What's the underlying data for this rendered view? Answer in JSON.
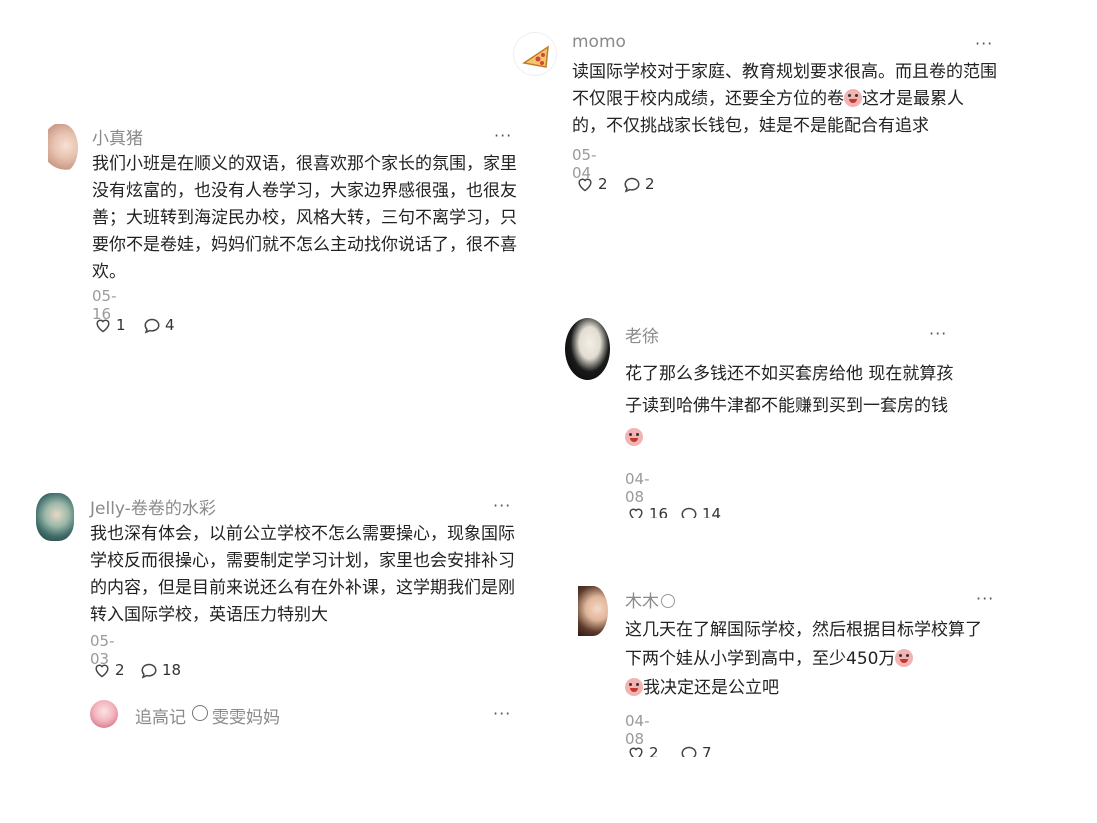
{
  "comments": [
    {
      "name": "小真猪",
      "text": "我们小班是在顺义的双语，很喜欢那个家长的氛围，家里没有炫富的，也没有人卷学习，大家边界感很强，也很友善；大班转到海淀民办校，风格大转，三句不离学习，只要你不是卷娃，妈妈们就不怎么主动找你说话了，很不喜欢。",
      "date": "05-16",
      "likes": "1",
      "replies": "4"
    },
    {
      "name": "Jelly-卷卷的水彩",
      "text": "我也深有体会，以前公立学校不怎么需要操心，现象国际学校反而很操心，需要制定学习计划，家里也会安排补习的内容，但是目前来说还么有在外补课，这学期我们是刚转入国际学校，英语压力特别大",
      "date": "05-03",
      "likes": "2",
      "replies": "18",
      "reply_preview": {
        "name": "追高记",
        "target": "雯雯妈妈"
      }
    },
    {
      "name": "momo",
      "text_a": "读国际学校对于家庭、教育规划要求很高。而且卷的范围不仅限于校内成绩，还要全方位的卷",
      "text_b": "这才是最累人的，不仅挑战家长钱包，娃是不是能配合有追求",
      "date": "05-04",
      "likes": "2",
      "replies": "2"
    },
    {
      "name": "老徐",
      "text": "花了那么多钱还不如买套房给他 现在就算孩子读到哈佛牛津都不能赚到买到一套房的钱",
      "date": "04-08",
      "likes": "16",
      "replies": "14"
    },
    {
      "name": "木木",
      "text_a": "这几天在了解国际学校，然后根据目标学校算了下两个娃从小学到高中，至少450万",
      "text_b": "我决定还是公立吧",
      "date": "04-08",
      "likes": "2",
      "replies": "7"
    }
  ],
  "more_label": "···",
  "icons": {
    "like": "heart-outline-icon",
    "reply": "comment-bubble-icon",
    "emoji": "crying-face-emoji"
  },
  "colors": {
    "meta": "#9a9a9a",
    "name": "#8a8a8a",
    "text": "#222222"
  }
}
